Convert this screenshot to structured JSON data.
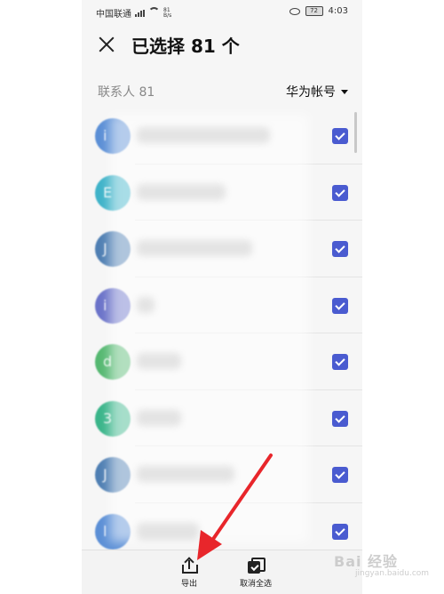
{
  "status_bar": {
    "carrier": "中国联通",
    "net_speed_value": "81",
    "net_speed_unit": "B/s",
    "battery": "72",
    "time": "4:03"
  },
  "header": {
    "title": "已选择 81 个"
  },
  "subheader": {
    "contacts_label": "联系人 81",
    "account": "华为帐号"
  },
  "contacts": [
    {
      "initial": "i",
      "color": "#5b8fd6",
      "checked": true
    },
    {
      "initial": "E",
      "color": "#3fb3c9",
      "checked": true
    },
    {
      "initial": "J",
      "color": "#4f7fb3",
      "checked": true
    },
    {
      "initial": "i",
      "color": "#6b73c9",
      "checked": true
    },
    {
      "initial": "d",
      "color": "#55b871",
      "checked": true
    },
    {
      "initial": "3",
      "color": "#3ab58a",
      "checked": true
    },
    {
      "initial": "J",
      "color": "#4f7fb3",
      "checked": true
    },
    {
      "initial": "l",
      "color": "#5b8fd6",
      "checked": true
    }
  ],
  "bottom_bar": {
    "export_label": "导出",
    "deselect_all_label": "取消全选"
  },
  "watermark": {
    "text": "Bai 经验",
    "sub": "jingyan.baidu.com"
  }
}
